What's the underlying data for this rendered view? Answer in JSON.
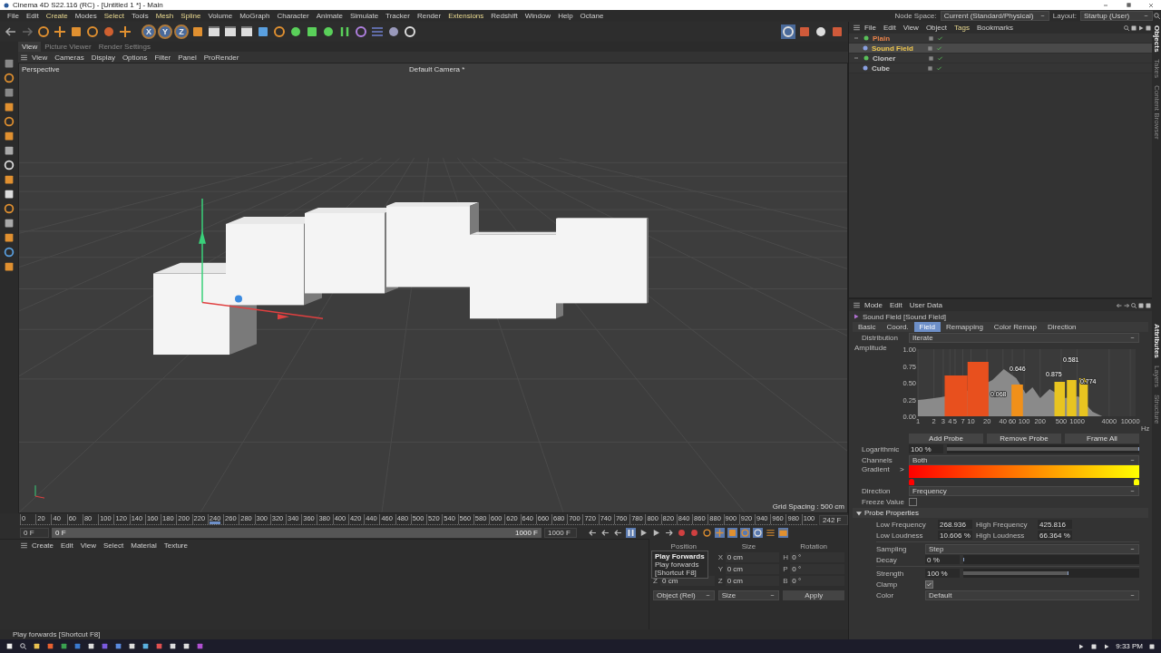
{
  "window": {
    "title": "Cinema 4D S22.116 (RC) - [Untitled 1 *] - Main"
  },
  "menu": [
    {
      "label": "File",
      "plugin": false
    },
    {
      "label": "Edit",
      "plugin": false
    },
    {
      "label": "Create",
      "plugin": true
    },
    {
      "label": "Modes",
      "plugin": false
    },
    {
      "label": "Select",
      "plugin": true
    },
    {
      "label": "Tools",
      "plugin": false
    },
    {
      "label": "Mesh",
      "plugin": true
    },
    {
      "label": "Spline",
      "plugin": true
    },
    {
      "label": "Volume",
      "plugin": false
    },
    {
      "label": "MoGraph",
      "plugin": false
    },
    {
      "label": "Character",
      "plugin": false
    },
    {
      "label": "Animate",
      "plugin": false
    },
    {
      "label": "Simulate",
      "plugin": false
    },
    {
      "label": "Tracker",
      "plugin": false
    },
    {
      "label": "Render",
      "plugin": false
    },
    {
      "label": "Extensions",
      "plugin": true
    },
    {
      "label": "Redshift",
      "plugin": false
    },
    {
      "label": "Window",
      "plugin": false
    },
    {
      "label": "Help",
      "plugin": false
    },
    {
      "label": "Octane",
      "plugin": false
    }
  ],
  "node_space": {
    "label": "Node Space:",
    "value": "Current (Standard/Physical)"
  },
  "layout": {
    "label": "Layout:",
    "value": "Startup (User)"
  },
  "axis_locks": [
    {
      "label": "X",
      "on": true
    },
    {
      "label": "Y",
      "on": true
    },
    {
      "label": "Z",
      "on": true
    }
  ],
  "view_tabs": [
    {
      "label": "View",
      "selected": true
    },
    {
      "label": "Picture Viewer",
      "selected": false
    },
    {
      "label": "Render Settings",
      "selected": false
    }
  ],
  "viewport": {
    "menu": [
      "View",
      "Cameras",
      "Display",
      "Options",
      "Filter",
      "Panel",
      "ProRender"
    ],
    "name": "Perspective",
    "camera": "Default Camera *",
    "grid_spacing": "Grid Spacing : 500 cm"
  },
  "timeline": {
    "ticks": [
      "0",
      "20",
      "40",
      "60",
      "80",
      "100",
      "120",
      "140",
      "160",
      "180",
      "200",
      "220",
      "240",
      "260",
      "280",
      "300",
      "320",
      "340",
      "360",
      "380",
      "400",
      "420",
      "440",
      "460",
      "480",
      "500",
      "520",
      "540",
      "560",
      "580",
      "600",
      "620",
      "640",
      "660",
      "680",
      "700",
      "720",
      "740",
      "760",
      "780",
      "800",
      "820",
      "840",
      "860",
      "880",
      "900",
      "920",
      "940",
      "960",
      "980",
      "100"
    ],
    "level": 0.242,
    "current": "242 F",
    "start": "0 F",
    "range_start": "0 F",
    "range_end": "1000 F",
    "end": "1000 F",
    "playing": true
  },
  "materials": {
    "menu": [
      "Create",
      "Edit",
      "View",
      "Select",
      "Material",
      "Texture"
    ]
  },
  "coordinates": {
    "headers": [
      "Position",
      "Size",
      "Rotation"
    ],
    "rows": [
      {
        "size_axis": "X",
        "size": "0 cm",
        "rot_axis": "H",
        "rotation": "0 °"
      },
      {
        "size_axis": "Y",
        "size": "0 cm",
        "rot_axis": "P",
        "rotation": "0 °"
      },
      {
        "pos_axis": "Z",
        "position": "0 cm",
        "size_axis": "Z",
        "size": "0 cm",
        "rot_axis": "B",
        "rotation": "0 °"
      }
    ],
    "mode": "Object (Rel)",
    "size_mode": "Size",
    "apply": "Apply"
  },
  "tooltip": {
    "title": "Play Forwards",
    "lines": [
      "Play forwards",
      "[Shortcut F8]"
    ]
  },
  "status": "Play forwards [Shortcut F8]",
  "objects": {
    "menu": [
      {
        "label": "File",
        "plugin": false
      },
      {
        "label": "Edit",
        "plugin": false
      },
      {
        "label": "View",
        "plugin": false
      },
      {
        "label": "Object",
        "plugin": false
      },
      {
        "label": "Tags",
        "plugin": true
      },
      {
        "label": "Bookmarks",
        "plugin": false
      }
    ],
    "tree": [
      {
        "name": "Plain",
        "color": "#e8824a",
        "selected": false,
        "expanded": true,
        "children": [
          {
            "name": "Sound Field",
            "color": "#f0c850",
            "selected": true
          }
        ]
      },
      {
        "name": "Cloner",
        "color": "#c8c8c8",
        "selected": false,
        "expanded": true,
        "children": [
          {
            "name": "Cube",
            "color": "#c8c8c8",
            "selected": false
          }
        ]
      }
    ]
  },
  "attributes": {
    "menu": [
      "Mode",
      "Edit",
      "User Data"
    ],
    "title": "Sound Field [Sound Field]",
    "tabs": [
      {
        "label": "Basic",
        "selected": false
      },
      {
        "label": "Coord.",
        "selected": false
      },
      {
        "label": "Field",
        "selected": true
      },
      {
        "label": "Remapping",
        "selected": false
      },
      {
        "label": "Color Remap",
        "selected": false
      },
      {
        "label": "Direction",
        "selected": false
      }
    ],
    "distribution": {
      "label": "Distribution",
      "value": "Iterate"
    },
    "amplitude": {
      "label": "Amplitude",
      "yticks": [
        "1.00",
        "0.75",
        "0.50",
        "0.25",
        "0.00"
      ],
      "xticks": [
        "1",
        "2",
        "3",
        "4",
        "5",
        "7",
        "10",
        "20",
        "40",
        "60",
        "100",
        "200",
        "500",
        "1000",
        "4000",
        "10000"
      ],
      "unit": "Hz",
      "probes": [
        {
          "label": "0.068",
          "color": "#e8501e"
        },
        {
          "label": "0.646",
          "color": "#f0901a"
        },
        {
          "label": "0.875",
          "color": "#e8c420"
        },
        {
          "label": "0.581",
          "color": "#e8c420"
        },
        {
          "label": "0.774",
          "color": "#e8c420"
        }
      ]
    },
    "buttons": [
      "Add Probe",
      "Remove Probe",
      "Frame All"
    ],
    "logarithmic": {
      "label": "Logarithmic",
      "value": "100 %",
      "level": 1
    },
    "channels": {
      "label": "Channels",
      "value": "Both"
    },
    "gradient": {
      "label": "Gradient",
      "expander": ">",
      "stops": [
        {
          "color": "#ff0000"
        },
        {
          "color": "#ffff00"
        }
      ]
    },
    "direction": {
      "label": "Direction",
      "value": "Frequency"
    },
    "freeze": {
      "label": "Freeze Value",
      "checked": false
    },
    "probe_section": {
      "label": "Probe Properties",
      "expanded": true
    },
    "probe_fields": [
      {
        "label": "Low Frequency",
        "value": "268.936"
      },
      {
        "label": "High Frequency",
        "value": "425.816"
      },
      {
        "label": "Low Loudness",
        "value": "10.606 %"
      },
      {
        "label": "High Loudness",
        "value": "66.364 %"
      }
    ],
    "sampling": {
      "label": "Sampling",
      "value": "Step"
    },
    "decay": {
      "label": "Decay",
      "value": "0 %",
      "level": 0
    },
    "strength": {
      "label": "Strength",
      "value": "100 %",
      "level": 0.6
    },
    "clamp": {
      "label": "Clamp",
      "checked": true
    },
    "color": {
      "label": "Color",
      "value": "Default"
    }
  },
  "side_tabs_top": [
    {
      "label": "Objects",
      "selected": true
    },
    {
      "label": "Takes",
      "selected": false
    },
    {
      "label": "Content Browser",
      "selected": false
    }
  ],
  "side_tabs_bottom": [
    {
      "label": "Attributes",
      "selected": true
    },
    {
      "label": "Layers",
      "selected": false
    },
    {
      "label": "Structure",
      "selected": false
    }
  ],
  "taskbar": {
    "time": "9:33 PM"
  }
}
